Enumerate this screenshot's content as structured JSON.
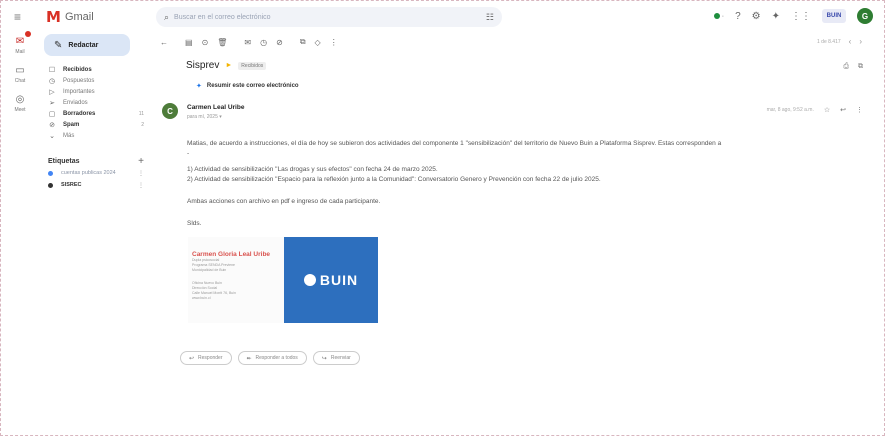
{
  "app": {
    "name": "Gmail"
  },
  "search": {
    "placeholder": "Buscar en el correo electrónico"
  },
  "topbar": {
    "status_label": "·",
    "org_badge": "BUIN",
    "avatar_letter": "G"
  },
  "rail": [
    {
      "label": "Mail"
    },
    {
      "label": "Chat"
    },
    {
      "label": "Meet"
    }
  ],
  "sidebar": {
    "compose_label": "Redactar",
    "items": [
      {
        "icon": "inbox-icon",
        "glyph": "☐",
        "label": "Recibidos",
        "count": "",
        "bold": true
      },
      {
        "icon": "snooze-icon",
        "glyph": "◷",
        "label": "Pospuestos",
        "count": "",
        "bold": false
      },
      {
        "icon": "important-icon",
        "glyph": "▷",
        "label": "Importantes",
        "count": "",
        "bold": false
      },
      {
        "icon": "sent-icon",
        "glyph": "➢",
        "label": "Enviados",
        "count": "",
        "bold": false
      },
      {
        "icon": "drafts-icon",
        "glyph": "▢",
        "label": "Borradores",
        "count": "11",
        "bold": true
      },
      {
        "icon": "spam-icon",
        "glyph": "⊘",
        "label": "Spam",
        "count": "2",
        "bold": true
      },
      {
        "icon": "more-icon",
        "glyph": "⌄",
        "label": "Más",
        "count": "",
        "bold": false
      }
    ],
    "labels_title": "Etiquetas",
    "labels": [
      {
        "name": "cuentas publicas 2024",
        "color": "#4285f4",
        "dark": false
      },
      {
        "name": "SISREC",
        "color": "#333333",
        "dark": true
      }
    ]
  },
  "toolbar": {
    "pager": "1 de 8.417"
  },
  "email": {
    "subject": "Sisprev",
    "tag": "Recibidos",
    "summary_label": "Resumir este correo electrónico",
    "sender_name": "Carmen Leal Uribe",
    "sender_to": "para mí, 2025 ▾",
    "date": "mar, 8 ago, 9:52 a.m.",
    "sender_initial": "C",
    "body": {
      "line1": "Matias, de acuerdo a instrucciones, el día de hoy se subieron dos actividades del componente 1 \"sensibilización\" del territorio de Nuevo Buin a Plataforma Sisprev. Estas corresponden a",
      "line2": "-",
      "line3": "1) Actividad de sensibilización \"Las drogas y sus efectos\" con fecha 24 de marzo 2025.",
      "line4": "2) Actividad de sensibilización \"Espacio para la reflexión junto a la Comunidad\": Conversatorio Genero y Prevención con fecha 22 de julio 2025.",
      "line5": "Ambas acciones con archivo en pdf e ingreso de cada participante.",
      "line6": "Slds."
    },
    "signature": {
      "name": "Carmen Gloria Leal Uribe",
      "line1": "Dupla psicosocial",
      "line2": "Programa SENDA Previene",
      "line3": "Municipalidad de Buin",
      "line4": "Oficina Nuevo Buin",
      "line5": "Dirección Social",
      "line6": "Calle Manuel Montt 76, Buin",
      "line7": "www.buin.cl",
      "logo_text": "BUIN"
    },
    "reply_buttons": [
      "Responder",
      "Responder a todos",
      "Reenviar"
    ]
  }
}
